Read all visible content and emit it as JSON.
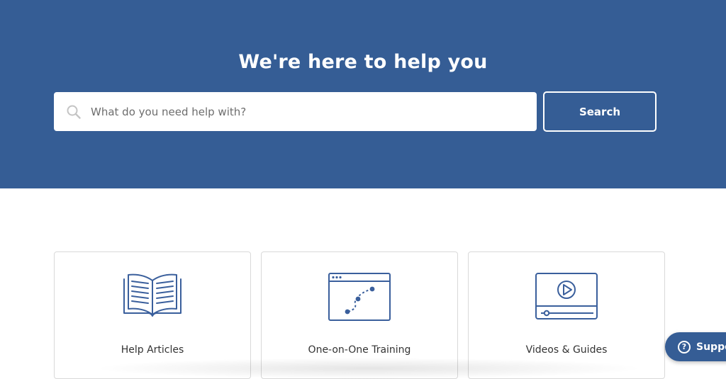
{
  "hero": {
    "title": "We're here to help you",
    "background_color": "#355d95"
  },
  "search": {
    "placeholder": "What do you need help with?",
    "value": "",
    "icon": "search-icon",
    "button_label": "Search"
  },
  "cards": [
    {
      "label": "Help Articles",
      "icon": "open-book-icon"
    },
    {
      "label": "One-on-One Training",
      "icon": "browser-path-icon"
    },
    {
      "label": "Videos & Guides",
      "icon": "video-player-icon"
    }
  ],
  "support_widget": {
    "label": "Support",
    "icon": "question-circle-icon"
  },
  "colors": {
    "accent": "#355d95",
    "icon_stroke": "#3a5f9c",
    "card_border": "#d9d9d9"
  }
}
